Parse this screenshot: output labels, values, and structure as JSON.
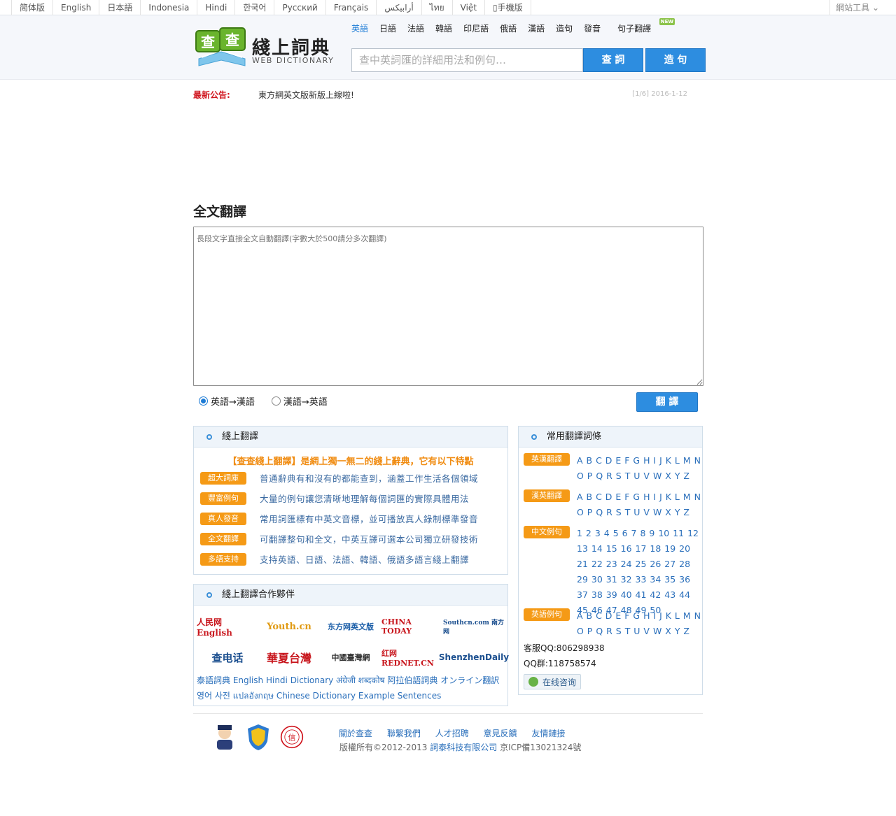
{
  "topbar": {
    "languages": [
      "简体版",
      "English",
      "日本語",
      "Indonesia",
      "Hindi",
      "한국어",
      "Русский",
      "Français",
      "أرابيكس",
      "ไทย",
      "Việt",
      "手機版"
    ],
    "tools": "網站工具"
  },
  "logo": {
    "title": "綫上詞典",
    "subtitle": "WEB DICTIONARY"
  },
  "nav": {
    "tabs": [
      "英語",
      "日語",
      "法語",
      "韓語",
      "印尼語",
      "俄語",
      "漢語",
      "造句",
      "發音"
    ],
    "highlight": "句子翻譯",
    "new_badge": "NEW"
  },
  "search": {
    "placeholder": "查中英詞匯的詳細用法和例句…",
    "search_btn": "查 詞",
    "make_btn": "造 句"
  },
  "notice": {
    "label": "最新公告:",
    "text": "東方網英文版新版上線啦!",
    "meta": "[1/6] 2016-1-12"
  },
  "translate": {
    "title": "全文翻譯",
    "placeholder": "長段文字直接全文自動翻譯(字數大於500請分多次翻譯)",
    "opt1": "英語→漢語",
    "opt2": "漢語→英語",
    "button": "翻 譯"
  },
  "online": {
    "title": "綫上翻譯",
    "slogan": "【查查綫上翻譯】是網上獨一無二的綫上辭典，它有以下特點",
    "features": [
      {
        "badge": "超大詞庫",
        "text": "普通辭典有和沒有的都能查到，涵蓋工作生活各個領域"
      },
      {
        "badge": "豐富例句",
        "text": "大量的例句讓您清晰地理解每個詞匯的實際具體用法"
      },
      {
        "badge": "真人發音",
        "text": "常用詞匯標有中英文音標，並可播放真人錄制標準發音"
      },
      {
        "badge": "全文翻譯",
        "text": "可翻譯整句和全文，中英互譯可選本公司獨立研發技術"
      },
      {
        "badge": "多語支持",
        "text": "支持英語、日語、法語、韓語、俄語多語言綫上翻譯"
      }
    ]
  },
  "partners": {
    "title": "綫上翻譯合作夥伴",
    "logos": [
      "人民网 English",
      "Youth.cn",
      "东方网英文版",
      "CHINA TODAY",
      "Southcn.com 南方网",
      "查电话",
      "華夏台灣",
      "中國臺灣網",
      "红网 REDNET.CN",
      "ShenzhenDaily"
    ],
    "links1": "泰語詞典 English Hindi Dictionary अंग्रेजी शब्दकोष 阿拉伯語詞典 オンライン翻訳",
    "links2": "영어 사전 แปลอังกฤษ Chinese Dictionary Example Sentences"
  },
  "common": {
    "title": "常用翻譯詞條",
    "rows": [
      {
        "badge": "英漢翻譯",
        "items": "A B C D E F G H I J K L M N O P Q R S T U V W X Y Z"
      },
      {
        "badge": "漢英翻譯",
        "items": "A B C D E F G H I J K L M N O P Q R S T U V W X Y Z"
      },
      {
        "badge": "中文例句",
        "items": "1 2 3 4 5 6 7 8 9 10 11 12 13 14 15 16 17 18 19 20 21 22 23 24 25 26 27 28 29 30 31 32 33 34 35 36 37 38 39 40 41 42 43 44 45 46 47 48 49 50"
      },
      {
        "badge": "英語例句",
        "items": "A B C D E F G H I J K L M N O P Q R S T U V W X Y Z"
      }
    ],
    "qq": "客服QQ:806298938",
    "qqgroup": "QQ群:118758574",
    "consult": "在线咨询"
  },
  "footer": {
    "links": [
      "關於查查",
      "聯繫我們",
      "人才招聘",
      "意見反饋",
      "友情鏈接"
    ],
    "copy_pre": "版權所有©2012-2013",
    "company": "詞泰科技有限公司",
    "icp": "京ICP備13021324號"
  }
}
